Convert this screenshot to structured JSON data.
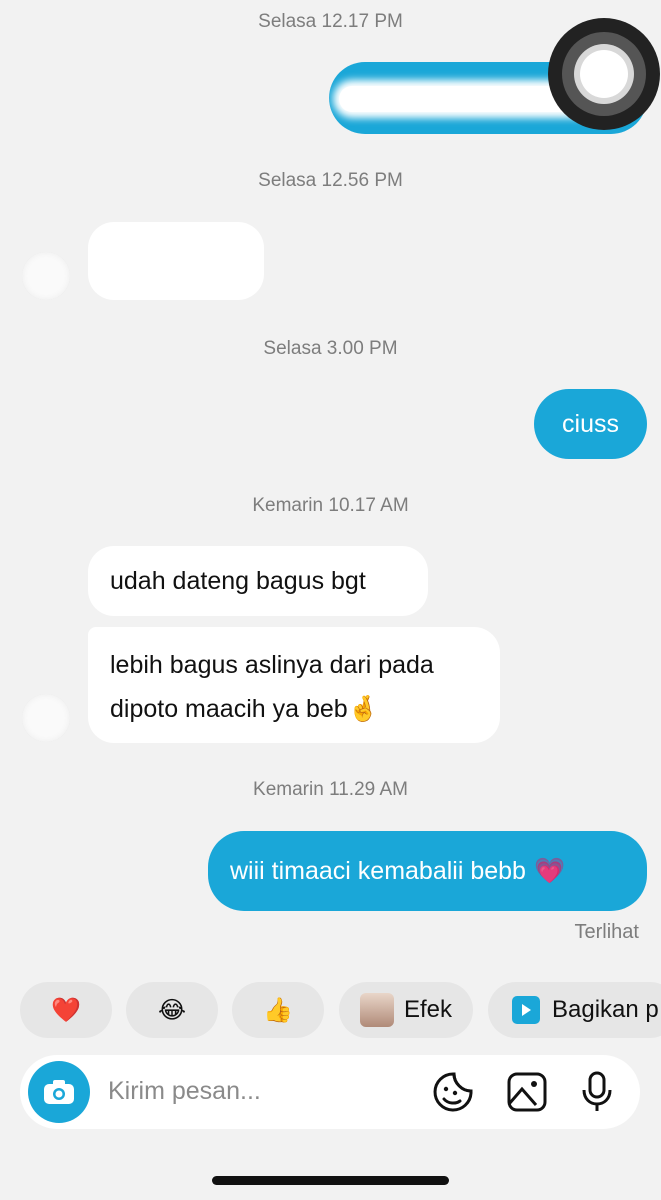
{
  "messages": {
    "ts1": "Selasa 12.17 PM",
    "ts2": "Selasa 12.56 PM",
    "ts3": "Selasa 3.00 PM",
    "ts4": "Kemarin 10.17 AM",
    "ts5": "Kemarin 11.29 AM",
    "out_ciuss": "ciuss",
    "in_udah": "udah dateng bagus bgt",
    "in_lebih_1": "lebih bagus aslinya dari pada",
    "in_lebih_2": "dipoto maacih ya beb",
    "in_lebih_emoji": "🤞",
    "out_wiii": "wiii timaaci kemabalii bebb",
    "out_wiii_emoji": "💗",
    "seen": "Terlihat"
  },
  "quick_actions": {
    "heart": "❤️",
    "laugh": "😂",
    "thumbs": "👍",
    "efek": "Efek",
    "share": "Bagikan p"
  },
  "composer": {
    "placeholder": "Kirim pesan..."
  },
  "colors": {
    "outgoing_bubble": "#1aa7d8",
    "incoming_bubble": "#ffffff",
    "background": "#f2f2f2",
    "timestamp": "#7d7d7d"
  },
  "icons": [
    "camera-icon",
    "sticker-icon",
    "gallery-icon",
    "microphone-icon",
    "play-icon"
  ]
}
